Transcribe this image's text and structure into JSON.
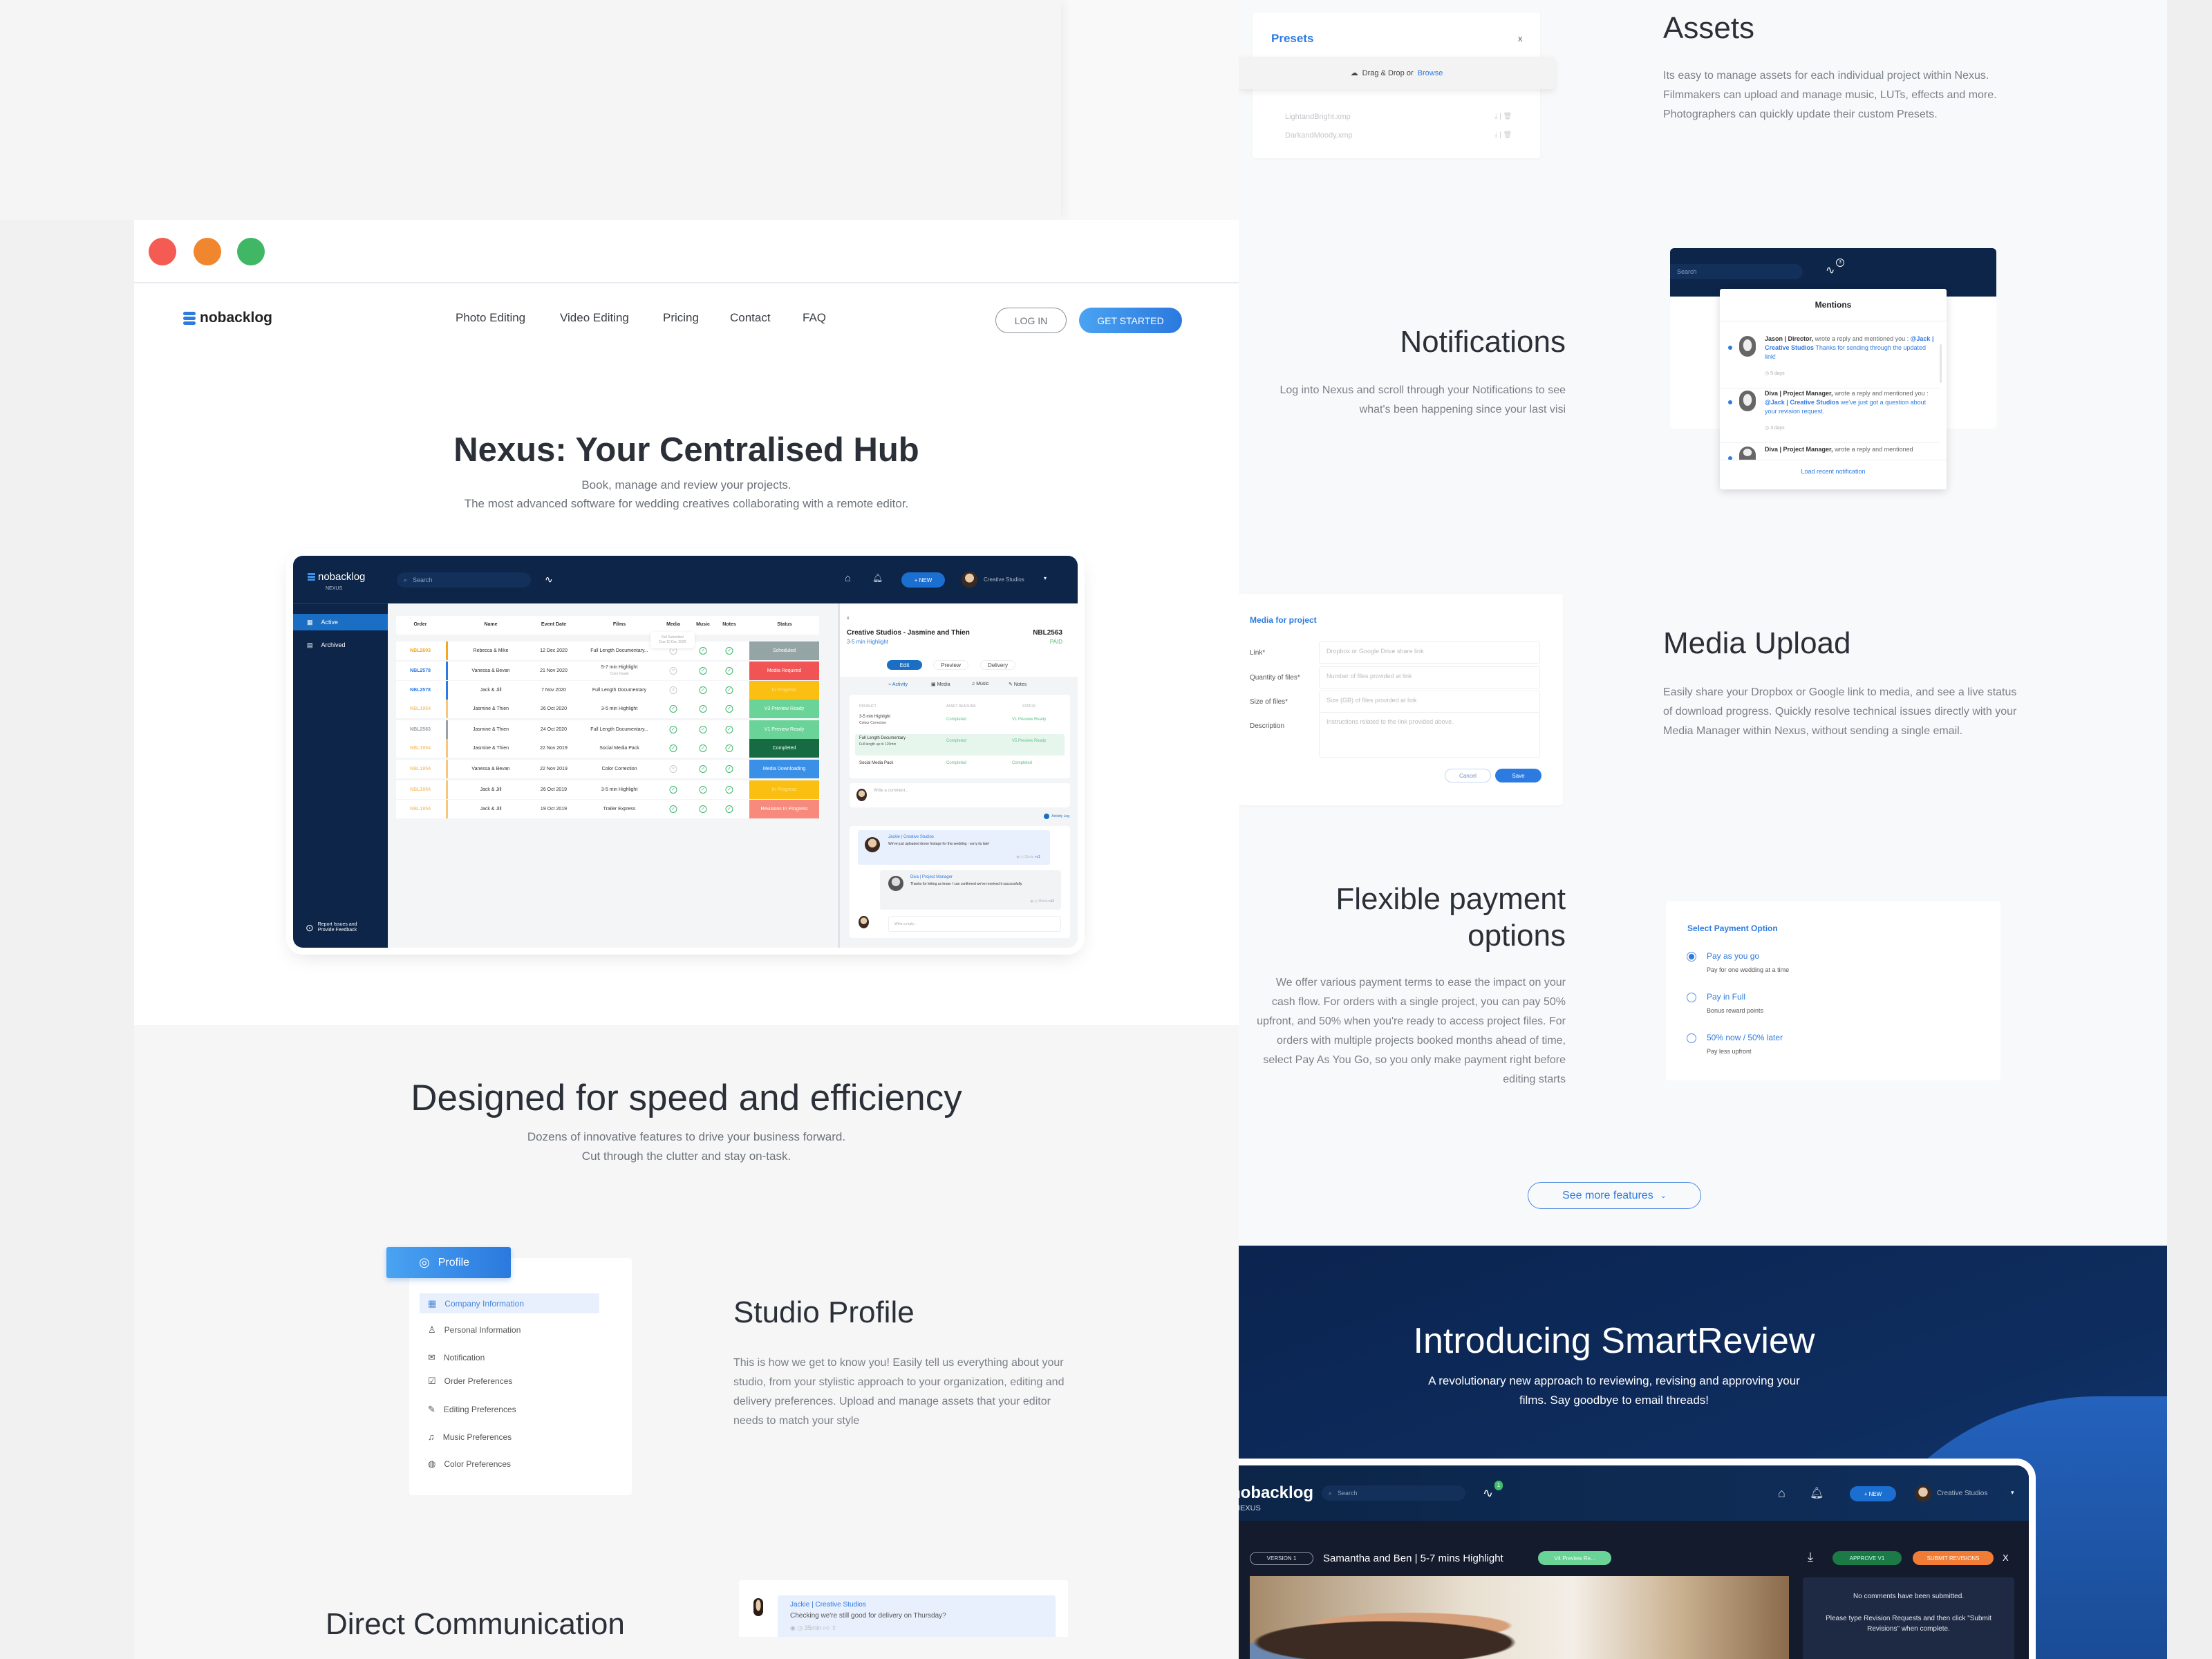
{
  "colors": {
    "accent": "#2d7be0",
    "navy": "#0c2548",
    "traffic_red": "#f45b52",
    "traffic_orange": "#f0862d",
    "traffic_green": "#3fb765"
  },
  "nav": {
    "logo": "nobacklog",
    "links": [
      "Photo Editing",
      "Video Editing",
      "Pricing",
      "Contact",
      "FAQ"
    ],
    "login": "LOG IN",
    "get_started": "GET STARTED"
  },
  "hero": {
    "title": "Nexus: Your Centralised Hub",
    "subtitle_1": "Book, manage and review your projects.",
    "subtitle_2": "The most advanced software for wedding creatives collaborating with a remote editor."
  },
  "dashboard": {
    "logo": "nobacklog",
    "logo_sub": "NEXUS",
    "search_placeholder": "Search",
    "new_label": "+ NEW",
    "user": "Creative Studios",
    "sidebar": [
      "Active",
      "Archived"
    ],
    "report": [
      "Report Issues and",
      "Provide Feedback"
    ],
    "columns": [
      "Order",
      "Name",
      "Event Date",
      "Films",
      "Media",
      "Music",
      "Notes",
      "Status"
    ],
    "tooltip": [
      "Not Submitted",
      "Due 10 Dec 2020"
    ],
    "rows": [
      {
        "order": "NBL2603",
        "order_color": "#f5a623",
        "name": "Rebecca & Mike",
        "date": "12 Dec 2020",
        "film": "Full Length Documentary...",
        "film_sub": "",
        "media": false,
        "music": true,
        "notes": true,
        "status": "Scheduled",
        "status_color": "#95a5a6"
      },
      {
        "order": "NBL2578",
        "order_color": "#2d7be0",
        "name": "Vanessa & Bevan",
        "date": "21 Nov 2020",
        "film": "5-7 min Highlight",
        "film_sub": "Color Grade",
        "media": false,
        "music": true,
        "notes": true,
        "status": "Media Required",
        "status_color": "#f05454"
      },
      {
        "order": "NBL2578",
        "order_color": "#2d7be0",
        "name": "Jack & Jill",
        "date": "7 Nov 2020",
        "film": "Full Length Documentary",
        "film_sub": "",
        "media": false,
        "music": true,
        "notes": true,
        "status": "In Progress",
        "status_color": "#fbbf11"
      },
      {
        "order": "NBL1954",
        "order_color": "#f7c77e",
        "name": "Jasmine & Thien",
        "date": "26 Oct 2020",
        "film": "3-5 min Highlight",
        "film_sub": "",
        "media": true,
        "music": true,
        "notes": true,
        "status": "V3 Preview Ready",
        "status_color": "#6ad398"
      },
      {
        "order": "NBL2563",
        "order_color": "#9aa0a6",
        "name": "Jasmine & Thien",
        "date": "24 Oct 2020",
        "film": "Full Length Documentary...",
        "film_sub": "",
        "media": true,
        "music": true,
        "notes": true,
        "status": "V1 Preview Ready",
        "status_color": "#6ad398"
      },
      {
        "order": "NBL1954",
        "order_color": "#f7c77e",
        "name": "Jasmine & Thien",
        "date": "22 Nov 2019",
        "film": "Social Media Pack",
        "film_sub": "",
        "media": true,
        "music": true,
        "notes": true,
        "status": "Completed",
        "status_color": "#176b43"
      },
      {
        "order": "NBL1954",
        "order_color": "#f7c77e",
        "name": "Vanessa & Bevan",
        "date": "22 Nov 2019",
        "film": "Color Correction",
        "film_sub": "",
        "media": false,
        "music": true,
        "notes": true,
        "status": "Media Downloading",
        "status_color": "#3a8fe6"
      },
      {
        "order": "NBL1954",
        "order_color": "#f7c77e",
        "name": "Jack & Jill",
        "date": "26 Oct 2019",
        "film": "3-5 min Highlight",
        "film_sub": "",
        "media": true,
        "music": true,
        "notes": true,
        "status": "In Progress",
        "status_color": "#fbbf11"
      },
      {
        "order": "NBL1954",
        "order_color": "#f7c77e",
        "name": "Jack & Jill",
        "date": "19 Oct 2019",
        "film": "Trailer Express",
        "film_sub": "",
        "media": true,
        "music": true,
        "notes": true,
        "status": "Revisions In Progress",
        "status_color": "#f88a7d"
      }
    ],
    "panel": {
      "close": "x",
      "title": "Creative Studios - Jasmine and Thien",
      "subtitle": "3-5 min Highlight",
      "order": "NBL2563",
      "paid": "PAID",
      "steps": [
        "Edit",
        "Preview",
        "Delivery"
      ],
      "tabs": [
        "Activity",
        "Media",
        "Music",
        "Notes"
      ],
      "product_headers": [
        "PRODUCT",
        "ASSET DEADLINE",
        "STATUS"
      ],
      "products": [
        {
          "name": "3-5 min Highlight",
          "sub": "Colour Correction",
          "deadline": "Completed",
          "status": "V1 Preview Ready"
        },
        {
          "name": "Full Length Documentary",
          "sub": "Full length up to 120min",
          "deadline": "Completed",
          "status": "V5 Preview Ready"
        },
        {
          "name": "Social Media Pack",
          "sub": "",
          "deadline": "Completed",
          "status": "Completed"
        }
      ],
      "comment_placeholder": "Write a comment...",
      "activity_log": "Activity Log",
      "comments": [
        {
          "author": "Jackie | Creative Studios",
          "text": "We've just uploaded drone footage for this wedding - sorry its late!",
          "time": "35min",
          "likes": "1"
        },
        {
          "author": "Diva | Project Manager",
          "text": "Thanks for letting us know. I can confirmed we've received it successfully.",
          "time": "35min",
          "likes": "1"
        }
      ],
      "reply_placeholder": "Write a reply..."
    }
  },
  "speed": {
    "title": "Designed for speed and efficiency",
    "sub_1": "Dozens of innovative features to drive your business forward.",
    "sub_2": "Cut through the clutter and stay on-task."
  },
  "profile": {
    "tab": "Profile",
    "items": [
      "Company Information",
      "Personal Information",
      "Notification",
      "Order Preferences",
      "Editing Preferences",
      "Music Preferences",
      "Color Preferences"
    ],
    "title": "Studio Profile",
    "text": "This is how we get to know you! Easily tell us everything about your studio, from your stylistic approach to your organization, editing and delivery preferences. Upload and manage assets that your editor needs to match your style"
  },
  "direct": {
    "title": "Direct Communication",
    "author": "Jackie | Creative Studios",
    "text": "Checking we're still good for delivery on Thursday?",
    "time": "35min"
  },
  "presets": {
    "title": "Presets",
    "close": "x",
    "drop": "Drag & Drop or",
    "browse": "Browse",
    "files": [
      "LightandBright.xmp",
      "DarkandMoody.xmp"
    ]
  },
  "assets": {
    "title": "Assets",
    "text": "Its easy to manage assets for each individual project within Nexus. Filmmakers can upload and manage music, LUTs, effects and more. Photographers can quickly update their custom Presets."
  },
  "notifications": {
    "title": "Notifications",
    "lines": [
      "Log into Nexus and scroll through your Notifications to see",
      "what's been happening since your last visi"
    ],
    "search": "Search",
    "badge": "3",
    "dropdown_title": "Mentions",
    "items": [
      {
        "author": "Jason | Director,",
        "action": " wrote a reply and mentioned you : ",
        "mention": "@Jack | Creative Studios",
        "text": " Thanks for sending through the updated link!",
        "time": "5 days"
      },
      {
        "author": "Diva | Project Manager,",
        "action": " wrote a reply and mentioned you : ",
        "mention": "@Jack | Creative Studios",
        "text": " we've just got a question about your revision request.",
        "time": "3 days"
      },
      {
        "author": "Diva | Project Manager,",
        "action": " wrote a reply and mentioned",
        "mention": "",
        "text": "",
        "time": ""
      }
    ],
    "load": "Load recent notification"
  },
  "media_form": {
    "title": "Media for project",
    "fields": [
      {
        "label": "Link*",
        "placeholder": "Dropbox or Google Drive share link"
      },
      {
        "label": "Quantity of files*",
        "placeholder": "Number of files provided at link"
      },
      {
        "label": "Size of files*",
        "placeholder": "Size (GB) of files provided at link"
      },
      {
        "label": "Description",
        "placeholder": "Instructions related to the link provided above."
      }
    ],
    "cancel": "Cancel",
    "save": "Save"
  },
  "media_upload": {
    "title": "Media Upload",
    "text": "Easily share your Dropbox or Google link to media, and see a live status of download progress. Quickly resolve technical issues directly with your Media Manager within Nexus, without sending a single email."
  },
  "payment": {
    "title_1": "Flexible payment",
    "title_2": "options",
    "lines": [
      "We offer various payment terms to ease the impact on your",
      "cash flow. For orders with a single project, you can pay 50%",
      "upfront, and 50% when you're ready to access project files. For",
      "orders with multiple projects booked months ahead of time,",
      "select Pay As You Go, so you only make payment right before",
      "editing starts"
    ],
    "card_title": "Select Payment Option",
    "selected": "Pay as you go",
    "options": [
      {
        "label": "Pay as you go",
        "sub": "Pay for one wedding at a time"
      },
      {
        "label": "Pay in Full",
        "sub": "Bonus reward points"
      },
      {
        "label": "50% now / 50% later",
        "sub": "Pay less upfront"
      }
    ]
  },
  "see_more": "See more features",
  "smartreview": {
    "title": "Introducing SmartReview",
    "sub_1": "A revolutionary new approach to reviewing, revising and approving your",
    "sub_2": "films. Say goodbye to email threads!",
    "logo": "nobacklog",
    "logo_sub": "NEXUS",
    "search": "Search",
    "badge": "1",
    "new_label": "+ NEW",
    "user": "Creative Studios",
    "version": "VERSION 1",
    "video_title": "Samantha and Ben | 5-7 mins Highlight",
    "status": "V4 Preview Re...",
    "approve": "APPROVE V1",
    "submit": "SUBMIT REVISIONS",
    "close": "X",
    "no_comments": "No comments have been submitted.",
    "instructions": "Please type Revision Requests and then click \"Submit Revisions\" when complete."
  }
}
